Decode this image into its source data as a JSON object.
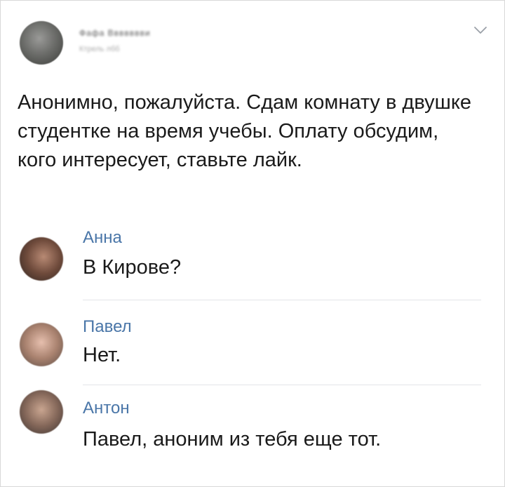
{
  "post": {
    "author_name": "Фафа Ввввввви",
    "meta": "Ктрель лбб",
    "text": "Анонимно, пожалуйста. Сдам комнату в двушке студентке на время учебы. Оплату обсудим, кого интересует, ставьте лайк."
  },
  "icons": {
    "menu": "chevron-down-icon"
  },
  "colors": {
    "author_link": "#4a76a8",
    "text": "#1a1a1a",
    "divider": "#e3e4e8"
  },
  "comments": [
    {
      "author": "Анна",
      "text": "В Кирове?"
    },
    {
      "author": "Павел",
      "text": "Нет."
    },
    {
      "author": "Антон",
      "text": "Павел, аноним из тебя еще тот."
    }
  ]
}
